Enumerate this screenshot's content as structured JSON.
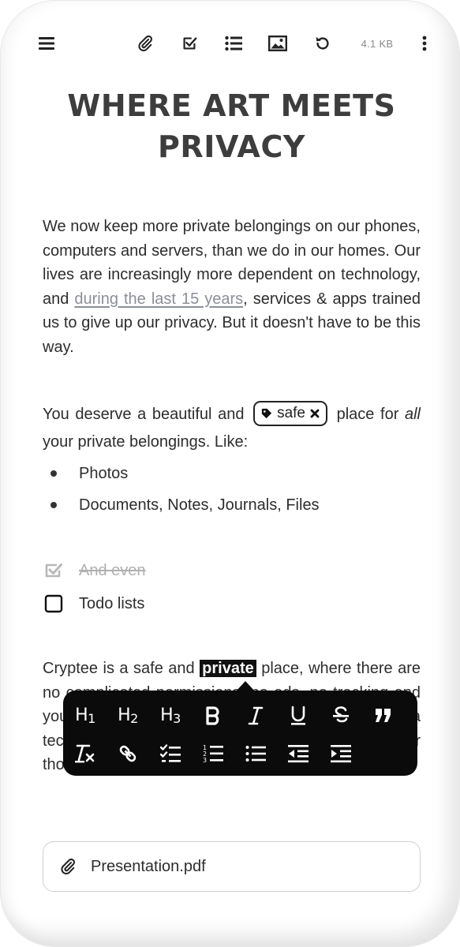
{
  "toolbar": {
    "menu_icon": "hamburger-icon",
    "attach_icon": "paperclip-icon",
    "task_icon": "checkbox-icon",
    "list_icon": "bullet-list-icon",
    "image_icon": "image-icon",
    "undo_icon": "undo-icon",
    "file_size": "4.1 KB",
    "more_icon": "vertical-dots-icon"
  },
  "document": {
    "title": "WHERE ART MEETS PRIVACY",
    "paragraph1": {
      "before_link": "We now keep more private belongings on our phones, computers and servers, than we do in our homes. Our lives are increasingly more dependent on technology, and ",
      "link_text": "during the last 15 years",
      "after_link": ", services & apps trained us to give up our privacy. But it doesn't have to be this way."
    },
    "paragraph2": {
      "before_tag": "You deserve a beautiful and",
      "tag_label": "safe",
      "after_tag_1": "place for ",
      "emphasis": "all",
      "after_tag_2": " your private belongings. Like:"
    },
    "bullets": [
      "Photos",
      "Documents, Notes, Journals, Files"
    ],
    "todos": [
      {
        "label": "And even",
        "checked": true
      },
      {
        "label": "Todo lists",
        "checked": false
      }
    ],
    "paragraph3": {
      "before_highlight": "Cryptee is a safe and ",
      "highlight": "private",
      "after_highlight": " place, where there are no complicated permissions, no ads, no tracking and you don't need to learn any features or have to be a tech-savvy person, and you can easily put your thoughts, notes and files together."
    },
    "attachment": {
      "icon": "paperclip-icon",
      "filename": "Presentation.pdf"
    }
  },
  "format_toolbar": {
    "row1": [
      "H1",
      "H2",
      "H3",
      "bold",
      "italic",
      "underline",
      "strikethrough",
      "blockquote"
    ],
    "row2": [
      "clear-format",
      "link",
      "checklist",
      "ordered-list",
      "bullet-list",
      "outdent",
      "indent"
    ]
  },
  "colors": {
    "text": "#2d2d2d",
    "title": "#3d3d3d",
    "link": "#8a8f97",
    "toolbar_bg": "#0b0b0b",
    "muted": "#b0b0b0"
  }
}
